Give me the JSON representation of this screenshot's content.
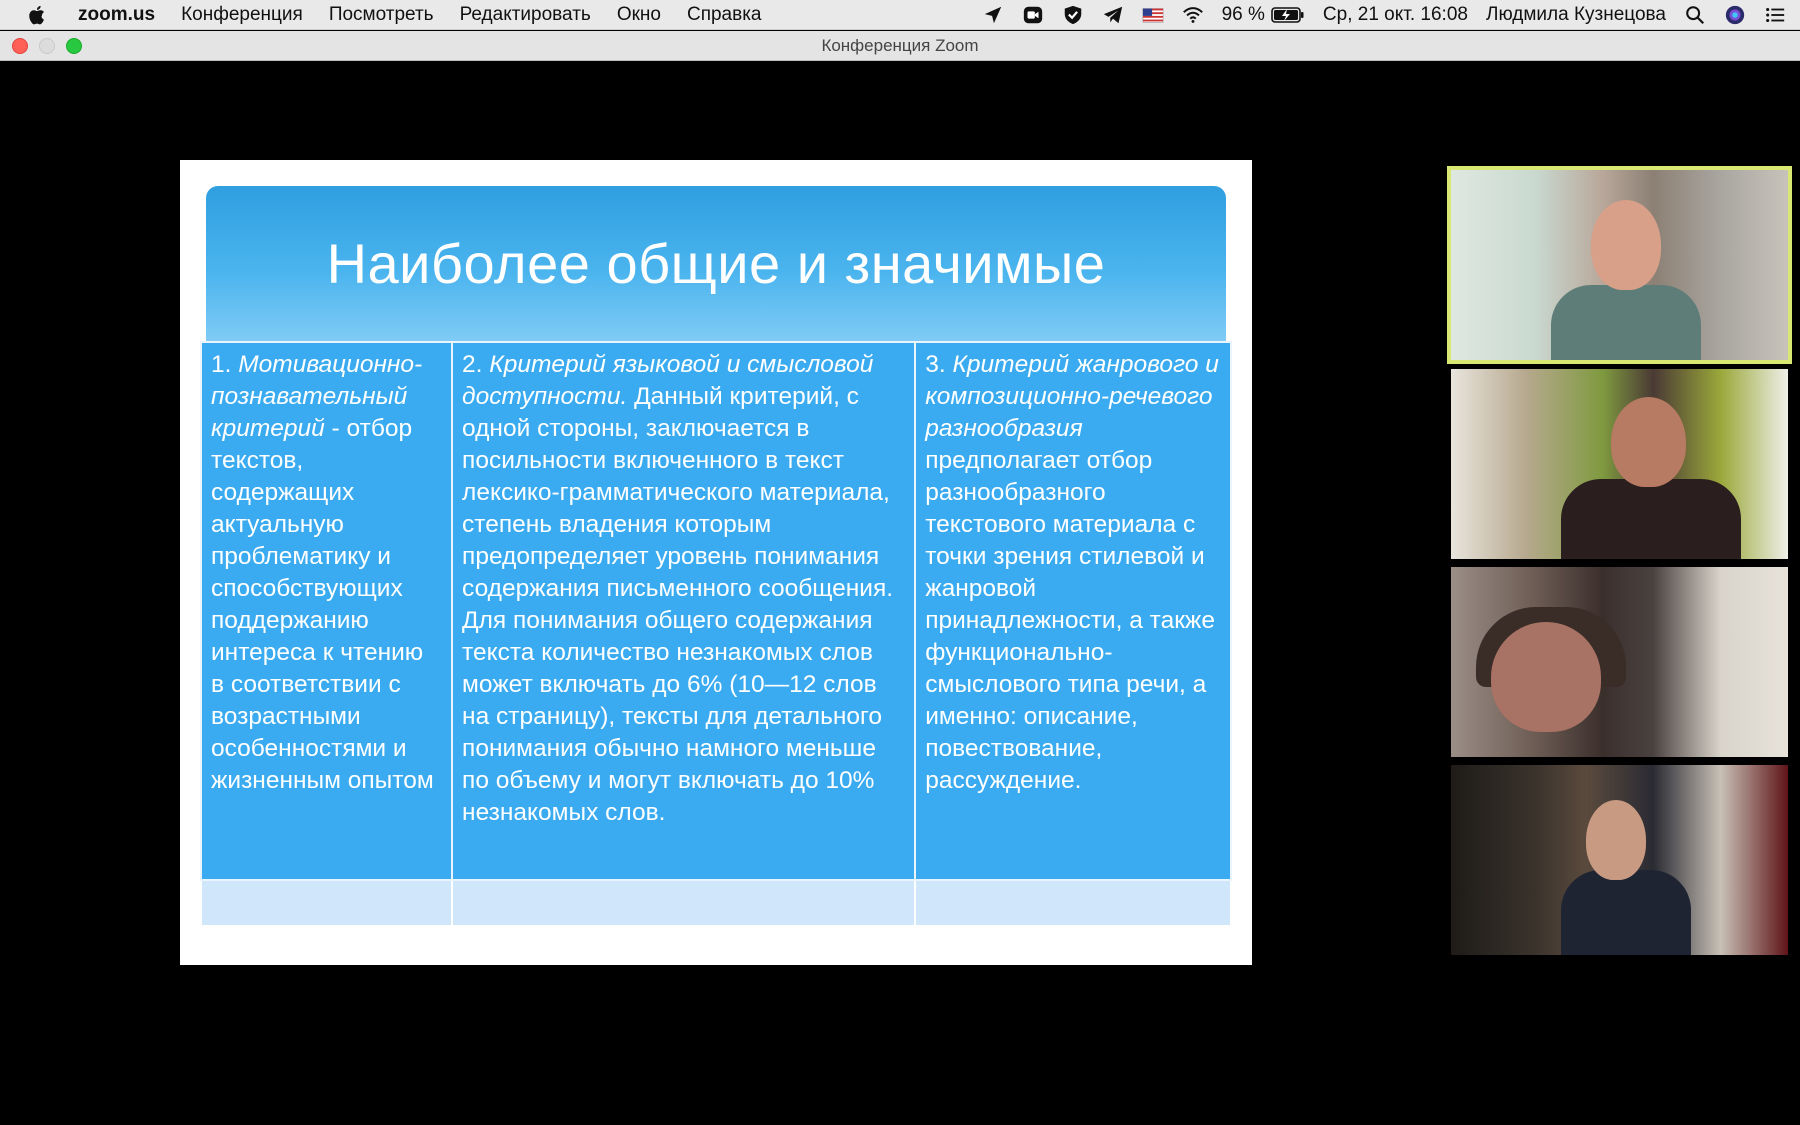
{
  "menubar": {
    "app_name": "zoom.us",
    "menus": [
      "Конференция",
      "Посмотреть",
      "Редактировать",
      "Окно",
      "Справка"
    ],
    "battery_text": "96 %",
    "datetime": "Ср, 21 окт.  16:08",
    "user_name": "Людмила Кузнецова"
  },
  "window": {
    "title": "Конференция Zoom"
  },
  "slide": {
    "title": "Наиболее общие и значимые",
    "col1": {
      "num": "1. ",
      "italic": "Мотивационно-познавательный критерий",
      "text": " - отбор текстов, содержащих актуальную проблематику и способствующих поддержанию интереса к чтению в соответствии с возрастными особенностями и жизненным опытом"
    },
    "col2": {
      "num": "2. ",
      "italic": "Критерий языковой и смысловой доступности.",
      "text": " Данный критерий, с одной стороны, заключается в посильности включенного в текст лексико-грамматического материала, степень владения которым предопределяет уровень понимания содержания письменного сообщения. Для понимания общего содержания текста количество незнакомых слов может включать до 6% (10—12 слов на страницу), тексты для детального понимания обычно намного меньше по объему и могут включать до 10% незнакомых слов."
    },
    "col3": {
      "num": "3. ",
      "italic": "Критерий жанрового и композиционно-речевого разнообразия",
      "text": " предполагает отбор разнообразного текстового материала с точки зрения стилевой и жанровой принадлежности, а также функционально-смыслового типа речи, а именно: описание, повествование, рассуждение."
    }
  },
  "colors": {
    "active_speaker_outline": "#d8e873",
    "slide_header_blue": "#2f9fe0",
    "slide_table_blue": "#3aabf0"
  }
}
